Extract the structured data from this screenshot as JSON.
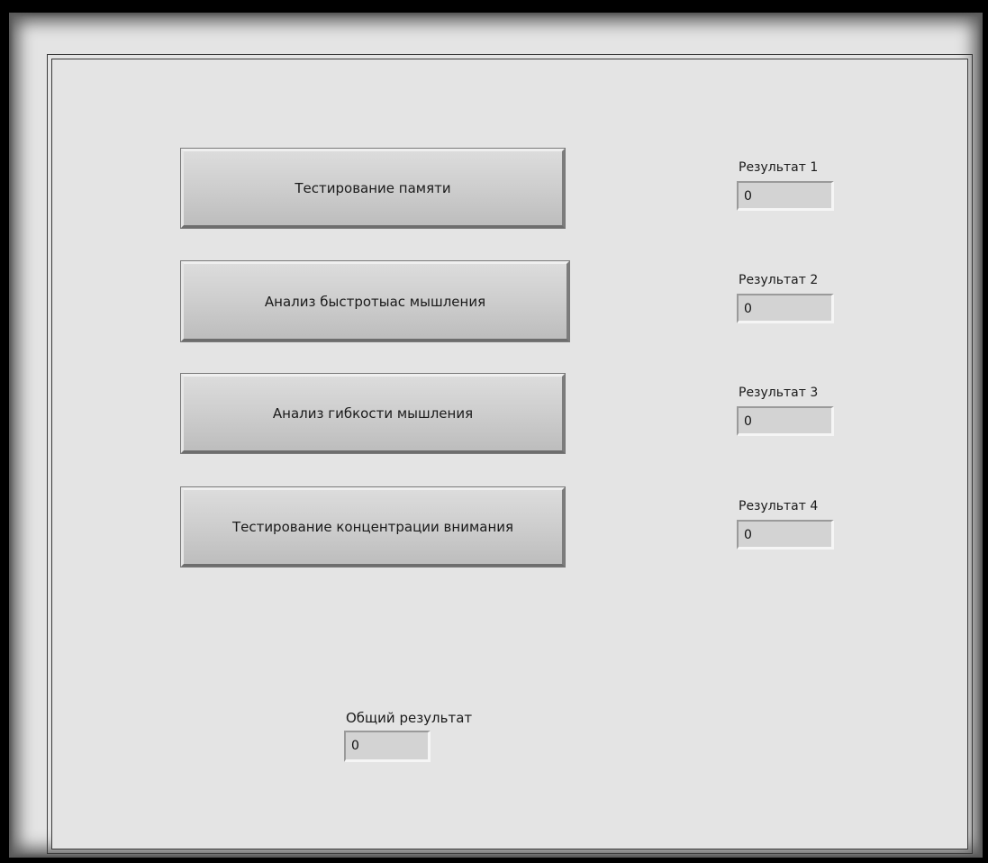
{
  "buttons": {
    "memory_test": "Тестирование памяти",
    "thinking_speed": "Анализ быстротыас мышления",
    "thinking_flexibility": "Анализ гибкости мышления",
    "attention_test": "Тестирование концентрации внимания"
  },
  "results": [
    {
      "label": "Результат 1",
      "value": "0"
    },
    {
      "label": "Результат 2",
      "value": "0"
    },
    {
      "label": "Результат 3",
      "value": "0"
    },
    {
      "label": "Результат 4",
      "value": "0"
    }
  ],
  "total": {
    "label": "Общий результат",
    "value": "0"
  }
}
